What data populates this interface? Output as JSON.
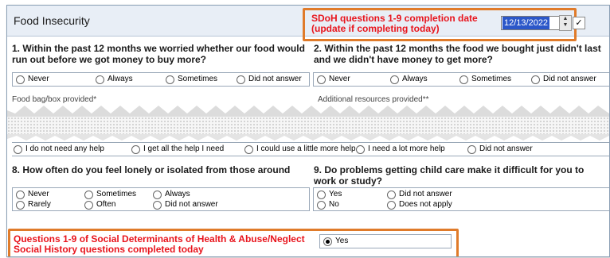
{
  "section": {
    "title": "Food Insecurity"
  },
  "completion": {
    "label": "SDoH questions 1-9 completion date (update if completing today)",
    "label_line1": "SDoH questions 1-9 completion date",
    "label_line2": "(update if completing today)",
    "date_value": "12/13/2022",
    "check": "✓"
  },
  "q1": {
    "text": "1. Within the past 12 months we worried whether our food would run out before we got money to buy more?",
    "options": [
      "Never",
      "Always",
      "Sometimes",
      "Did not answer"
    ]
  },
  "q2": {
    "text": "2. Within the past 12 months the food we bought just didn't last and we didn't have money to get more?",
    "options": [
      "Never",
      "Always",
      "Sometimes",
      "Did not answer"
    ]
  },
  "partial": {
    "food_bag_label": "Food bag/box provided*",
    "additional_label": "Additional resources provided**",
    "help_options": [
      "I do not need any help",
      "I get all the help I need",
      "I could use a little more help",
      "I need a lot more help",
      "Did not answer"
    ]
  },
  "q8": {
    "text": "8. How often do you feel lonely or isolated from those around",
    "options": [
      "Never",
      "Sometimes",
      "Always",
      "Rarely",
      "Often",
      "Did not answer"
    ]
  },
  "q9": {
    "text": "9. Do problems getting child care make it difficult for you to work or study?",
    "options": [
      "Yes",
      "Did not answer",
      "No",
      "Does not apply"
    ]
  },
  "completed": {
    "label_line1": "Questions 1-9 of Social Determinants of Health & Abuse/Neglect",
    "label_line2": "Social History questions completed today",
    "option": "Yes",
    "selected": true
  },
  "colors": {
    "callout": "#e07b2a",
    "red_text": "#e8141c",
    "header_bg": "#e8eef6",
    "date_highlight": "#2b57c9"
  }
}
